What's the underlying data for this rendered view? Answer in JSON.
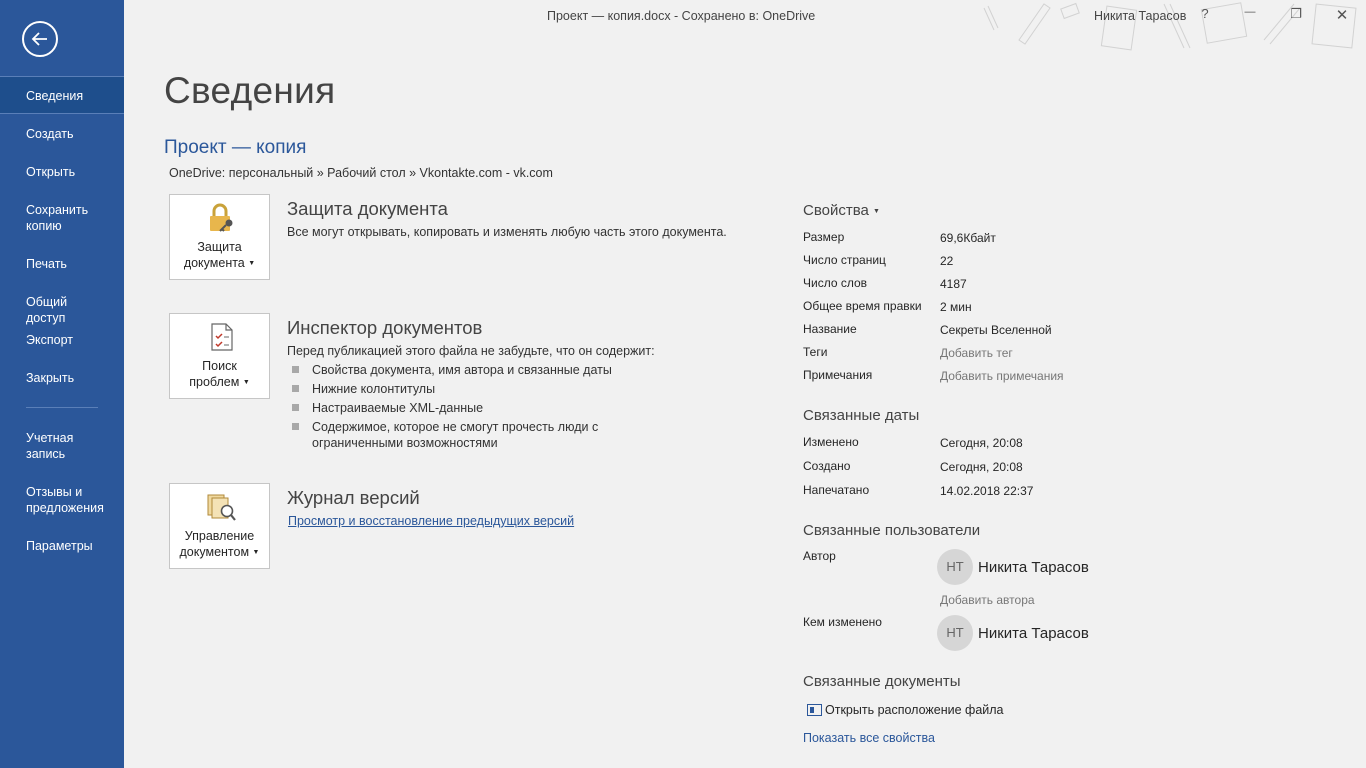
{
  "titlebar": {
    "doc_title": "Проект — копия.docx  -  Сохранено в: OneDrive",
    "user_name": "Никита Тарасов",
    "help": "?",
    "minimize": "—",
    "restore": "❐",
    "close": "✕"
  },
  "sidebar": {
    "items": [
      {
        "label": "Сведения",
        "active": true
      },
      {
        "label": "Создать"
      },
      {
        "label": "Открыть"
      },
      {
        "label": "Сохранить копию"
      },
      {
        "label": "Печать"
      },
      {
        "label": "Общий доступ"
      },
      {
        "label": "Экспорт"
      },
      {
        "label": "Закрыть"
      },
      {
        "label": "Учетная запись"
      },
      {
        "label": "Отзывы и предложения"
      },
      {
        "label": "Параметры"
      }
    ]
  },
  "main": {
    "page_title": "Сведения",
    "doc_name": "Проект — копия",
    "doc_path": "OneDrive: персональный » Рабочий стол » Vkontakte.com - vk.com",
    "protect": {
      "tile_label_1": "Защита",
      "tile_label_2": "документа",
      "title": "Защита документа",
      "desc": "Все могут открывать, копировать и изменять любую часть этого документа."
    },
    "inspect": {
      "tile_label_1": "Поиск",
      "tile_label_2": "проблем",
      "title": "Инспектор документов",
      "desc": "Перед публикацией этого файла не забудьте, что он содержит:",
      "bullets": [
        "Свойства документа, имя автора и связанные даты",
        "Нижние колонтитулы",
        "Настраиваемые XML-данные",
        "Содержимое, которое не смогут прочесть люди с ограниченными возможностями"
      ]
    },
    "versions": {
      "tile_label_1": "Управление",
      "tile_label_2": "документом",
      "title": "Журнал версий",
      "link": "Просмотр и восстановление предыдущих версий"
    }
  },
  "properties": {
    "header": "Свойства",
    "rows": [
      {
        "label": "Размер",
        "value": "69,6Кбайт"
      },
      {
        "label": "Число страниц",
        "value": "22"
      },
      {
        "label": "Число слов",
        "value": "4187"
      },
      {
        "label": "Общее время правки",
        "value": "2 мин"
      },
      {
        "label": "Название",
        "value": "Секреты Вселенной"
      },
      {
        "label": "Теги",
        "value": "Добавить тег"
      },
      {
        "label": "Примечания",
        "value": "Добавить примечания"
      }
    ],
    "dates_header": "Связанные даты",
    "dates": [
      {
        "label": "Изменено",
        "value": "Сегодня, 20:08"
      },
      {
        "label": "Создано",
        "value": "Сегодня, 20:08"
      },
      {
        "label": "Напечатано",
        "value": "14.02.2018 22:37"
      }
    ],
    "users_header": "Связанные пользователи",
    "author_label": "Автор",
    "author_initials": "НТ",
    "author_name": "Никита Тарасов",
    "add_author": "Добавить автора",
    "modified_by_label": "Кем изменено",
    "modified_initials": "НТ",
    "modified_name": "Никита Тарасов",
    "docs_header": "Связанные документы",
    "open_location": "Открыть расположение файла",
    "show_all": "Показать все свойства"
  }
}
